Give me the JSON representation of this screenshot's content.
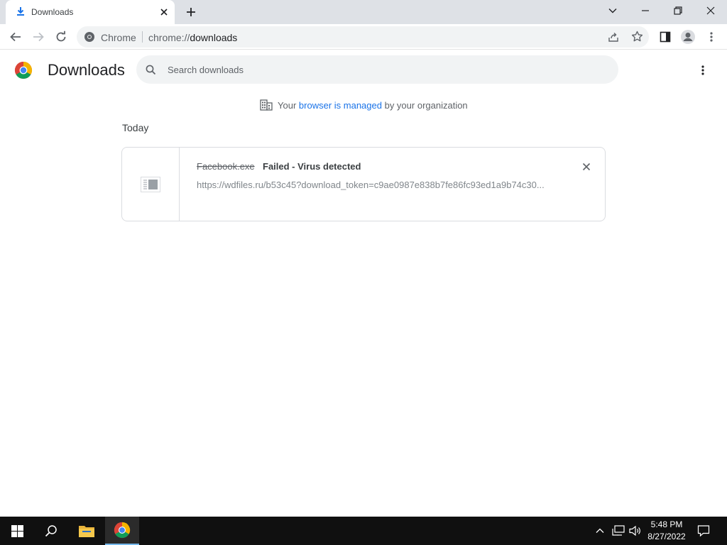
{
  "browser": {
    "tab_title": "Downloads",
    "new_tab_label": "+",
    "omnibox_site_label": "Chrome",
    "url_scheme": "chrome://",
    "url_path": "downloads"
  },
  "page": {
    "title": "Downloads",
    "search_placeholder": "Search downloads",
    "managed_prefix": "Your",
    "managed_link": "browser is managed",
    "managed_suffix": "by your organization",
    "date_header": "Today"
  },
  "downloads": [
    {
      "file_name": "Facebook.exe",
      "status": "Failed - Virus detected",
      "url": "https://wdfiles.ru/b53c45?download_token=c9ae0987e838b7fe86fc93ed1a9b74c30..."
    }
  ],
  "taskbar": {
    "time": "5:48 PM",
    "date": "8/27/2022",
    "pinned": [
      "start-icon",
      "search-icon",
      "file-explorer-icon",
      "chrome-icon"
    ]
  },
  "colors": {
    "accent": "#1a73e8",
    "tabstrip": "#dee1e6",
    "taskbar": "#101010",
    "download_icon": "#1a73e8"
  }
}
